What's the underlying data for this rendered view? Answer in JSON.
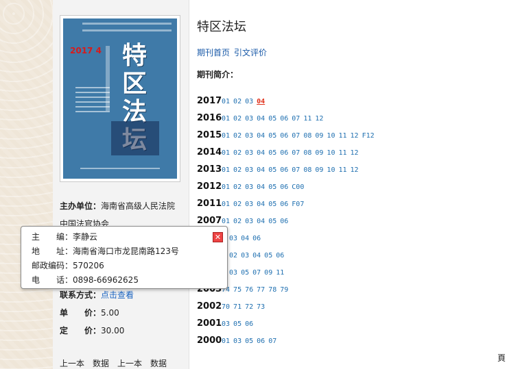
{
  "journal": {
    "title": "特区法坛",
    "cover_title": "特区法坛",
    "cover_year": "2017 4",
    "nav": [
      "期刊首页",
      "引文评价"
    ],
    "intro_label": "期刊简介："
  },
  "info": {
    "sponsor_label": "主办单位：",
    "sponsor_value": "海南省高级人民法院",
    "sponsor_value2": "中国法官协会",
    "contact_label": "联系方式：",
    "contact_link": "点击查看",
    "price_label": "单　　价：",
    "price_value": "5.00",
    "fixed_label": "定　　价：",
    "fixed_value": "30.00"
  },
  "popup": {
    "editor_label": "主　　编：",
    "editor_value": "李静云",
    "address_label": "地　　址：",
    "address_value": "海南省海口市龙昆南路123号",
    "postcode_label": "邮政编码：",
    "postcode_value": "570206",
    "phone_label": "电　　话：",
    "phone_value": "0898-66962625",
    "close_icon": "close-icon"
  },
  "years": [
    {
      "year": "2017",
      "issues": [
        "01",
        "02",
        "03",
        "04"
      ],
      "current": "04"
    },
    {
      "year": "2016",
      "issues": [
        "01",
        "02",
        "03",
        "04",
        "05",
        "06",
        "07",
        "11",
        "12"
      ]
    },
    {
      "year": "2015",
      "issues": [
        "01",
        "02",
        "03",
        "04",
        "05",
        "06",
        "07",
        "08",
        "09",
        "10",
        "11",
        "12",
        "F12"
      ]
    },
    {
      "year": "2014",
      "issues": [
        "01",
        "02",
        "03",
        "04",
        "05",
        "06",
        "07",
        "08",
        "09",
        "10",
        "11",
        "12"
      ]
    },
    {
      "year": "2013",
      "issues": [
        "01",
        "02",
        "03",
        "04",
        "05",
        "06",
        "07",
        "08",
        "09",
        "10",
        "11",
        "12"
      ]
    },
    {
      "year": "2012",
      "issues": [
        "01",
        "02",
        "03",
        "04",
        "05",
        "06",
        "C00"
      ]
    },
    {
      "year": "2011",
      "issues": [
        "01",
        "02",
        "03",
        "04",
        "05",
        "06",
        "F07"
      ]
    },
    {
      "year": "2007",
      "issues": [
        "01",
        "02",
        "03",
        "04",
        "05",
        "06"
      ]
    },
    {
      "year": "",
      "issues": [
        "1",
        "03",
        "04",
        "06"
      ]
    },
    {
      "year": "",
      "issues": [
        "1",
        "02",
        "03",
        "04",
        "05",
        "06"
      ]
    },
    {
      "year": "",
      "issues": [
        "1",
        "03",
        "05",
        "07",
        "09",
        "11"
      ]
    },
    {
      "year": "2003",
      "issues": [
        "74",
        "75",
        "76",
        "77",
        "78",
        "79"
      ]
    },
    {
      "year": "2002",
      "issues": [
        "70",
        "71",
        "72",
        "73"
      ]
    },
    {
      "year": "2001",
      "issues": [
        "03",
        "05",
        "06"
      ]
    },
    {
      "year": "2000",
      "issues": [
        "01",
        "03",
        "05",
        "06",
        "07"
      ]
    }
  ],
  "edge_char": "頁",
  "bottom_partial": "上一本　数据　上一本　数据"
}
